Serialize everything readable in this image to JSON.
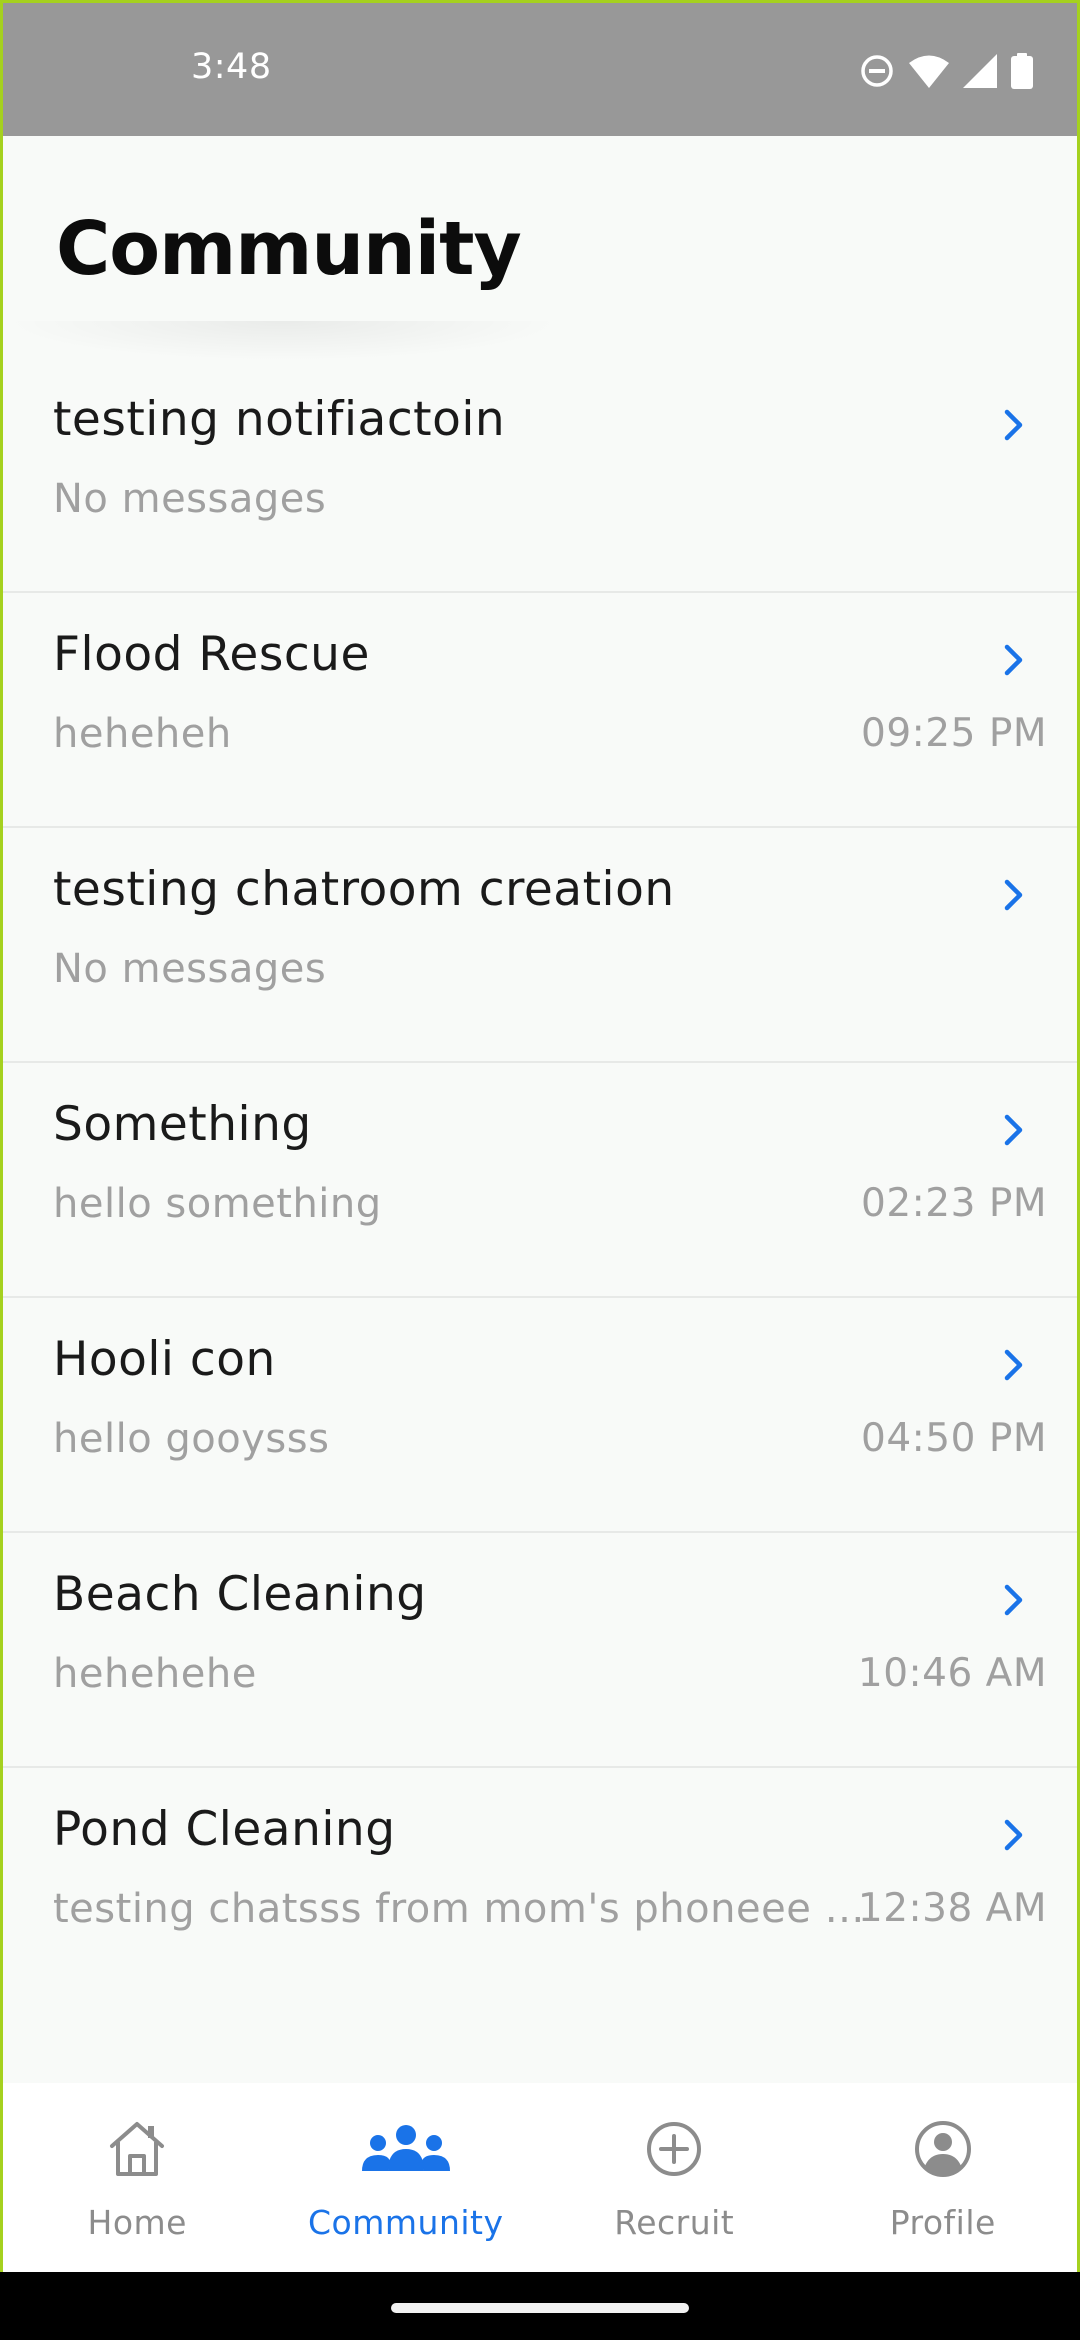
{
  "status_bar": {
    "time": "3:48",
    "icons": [
      "do-not-disturb-icon",
      "wifi-icon",
      "cell-signal-icon",
      "battery-icon"
    ]
  },
  "page": {
    "title": "Community"
  },
  "chats": [
    {
      "name": "testing notifiactoin",
      "preview": "No messages",
      "time": ""
    },
    {
      "name": "Flood Rescue",
      "preview": "heheheh",
      "time": "09:25 PM"
    },
    {
      "name": "testing chatroom creation",
      "preview": "No messages",
      "time": ""
    },
    {
      "name": "Something",
      "preview": "hello something",
      "time": "02:23 PM"
    },
    {
      "name": "Hooli con",
      "preview": "hello gooysss",
      "time": "04:50 PM"
    },
    {
      "name": "Beach Cleaning",
      "preview": "hehehehe",
      "time": "10:46 AM"
    },
    {
      "name": "Pond Cleaning",
      "preview": "testing chatsss from mom's phoneee yay",
      "time": "12:38 AM"
    }
  ],
  "bottom_nav": {
    "items": [
      {
        "label": "Home",
        "icon": "home-icon",
        "active": false
      },
      {
        "label": "Community",
        "icon": "community-icon",
        "active": true
      },
      {
        "label": "Recruit",
        "icon": "add-circle-icon",
        "active": false
      },
      {
        "label": "Profile",
        "icon": "profile-icon",
        "active": false
      }
    ]
  },
  "colors": {
    "accent": "#1a73e8",
    "status_bar": "#989898",
    "background": "#f8faf8",
    "muted_text": "#a0a0a0",
    "inactive_nav": "#8c8c8c"
  }
}
